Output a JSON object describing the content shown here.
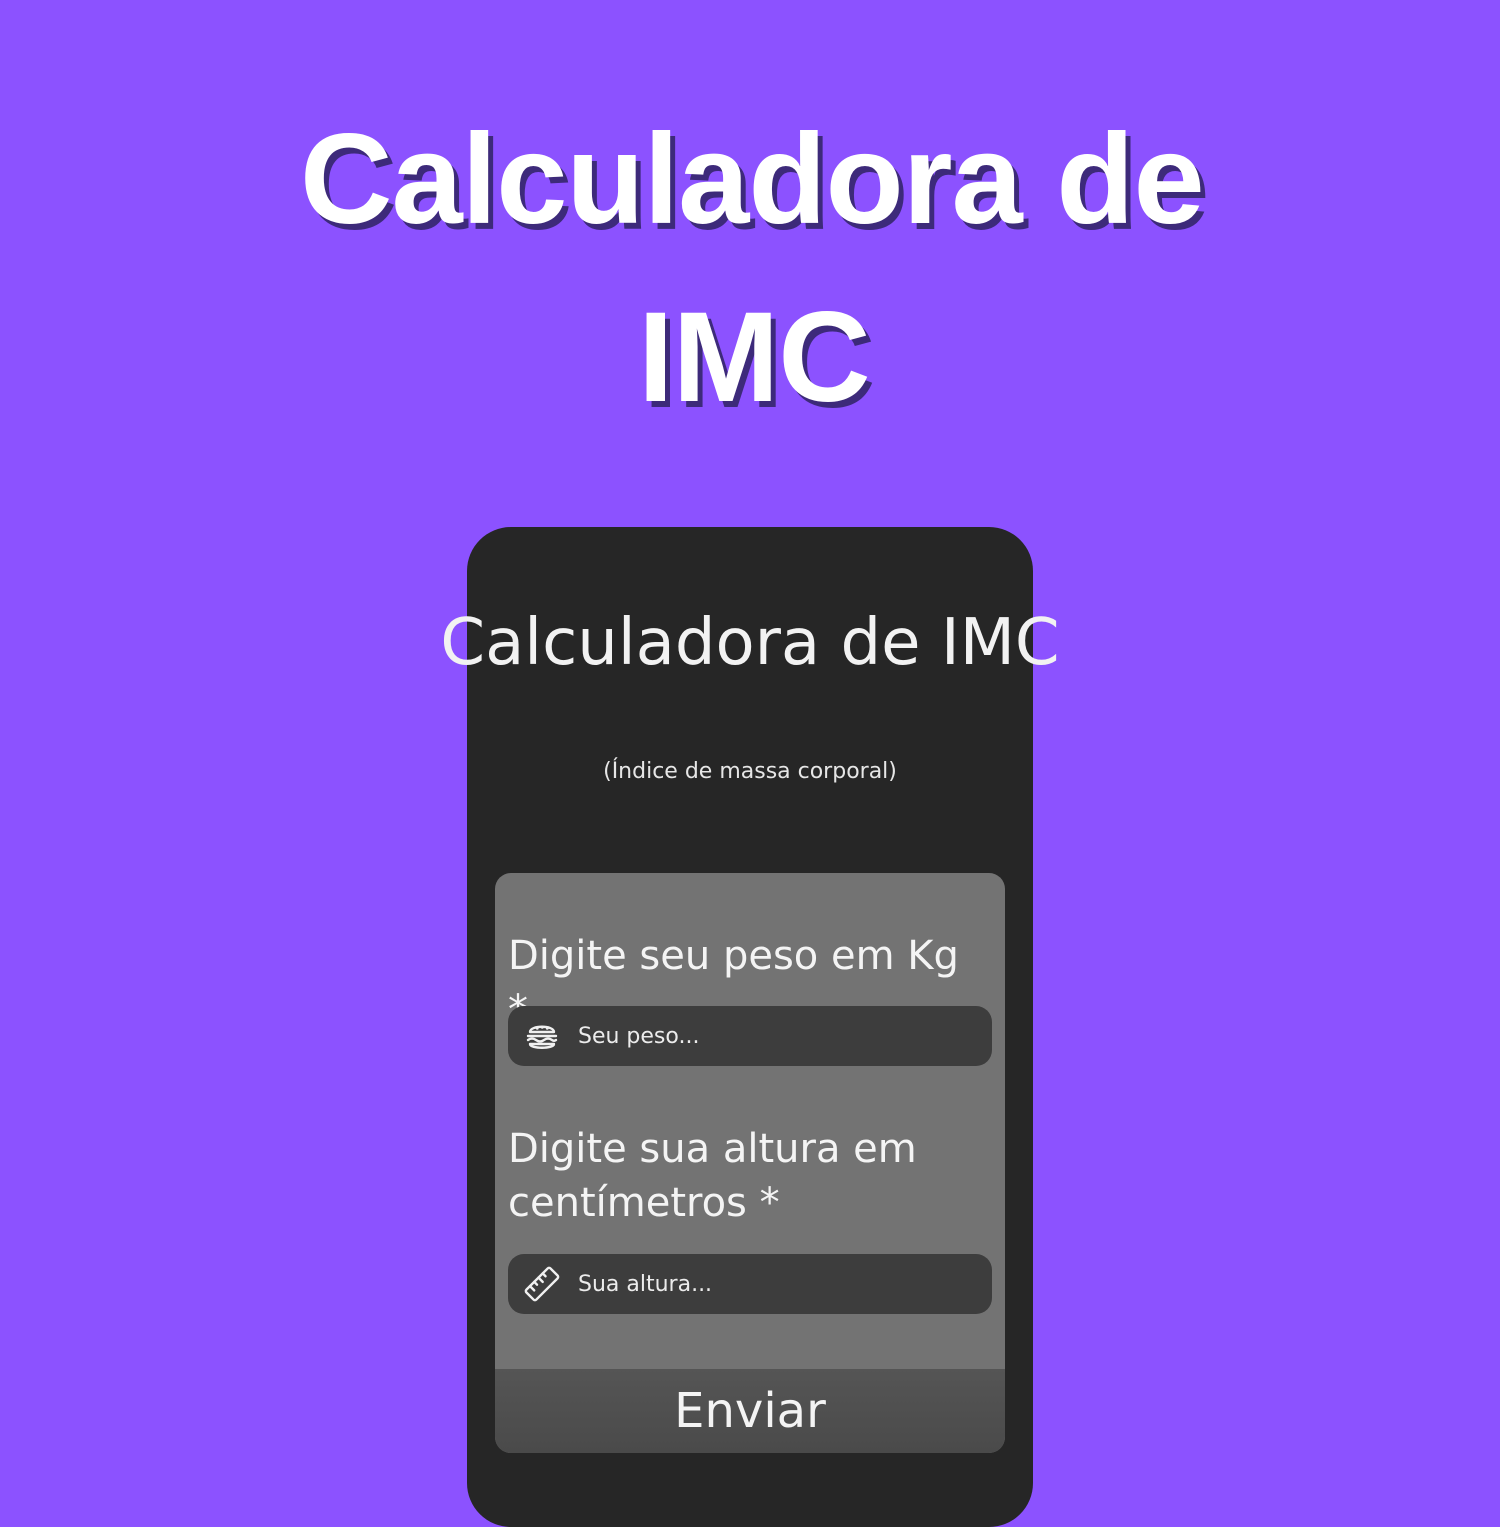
{
  "hero": {
    "title_line1": "Calculadora de",
    "title_line2": "IMC"
  },
  "card": {
    "title": "Calculadora de IMC",
    "subtitle": "(Índice de massa corporal)"
  },
  "form": {
    "weight_label": "Digite seu peso em Kg *",
    "weight_placeholder": "Seu peso...",
    "weight_icon": "burger-icon",
    "height_label": "Digite sua altura em centímetros *",
    "height_placeholder": "Sua altura...",
    "height_icon": "ruler-icon",
    "submit_label": "Enviar"
  },
  "colors": {
    "background": "#8c52ff",
    "card": "#262626",
    "panel": "#737373",
    "input": "#3d3d3d",
    "button": "#4f4f4f",
    "text": "#ffffff"
  }
}
